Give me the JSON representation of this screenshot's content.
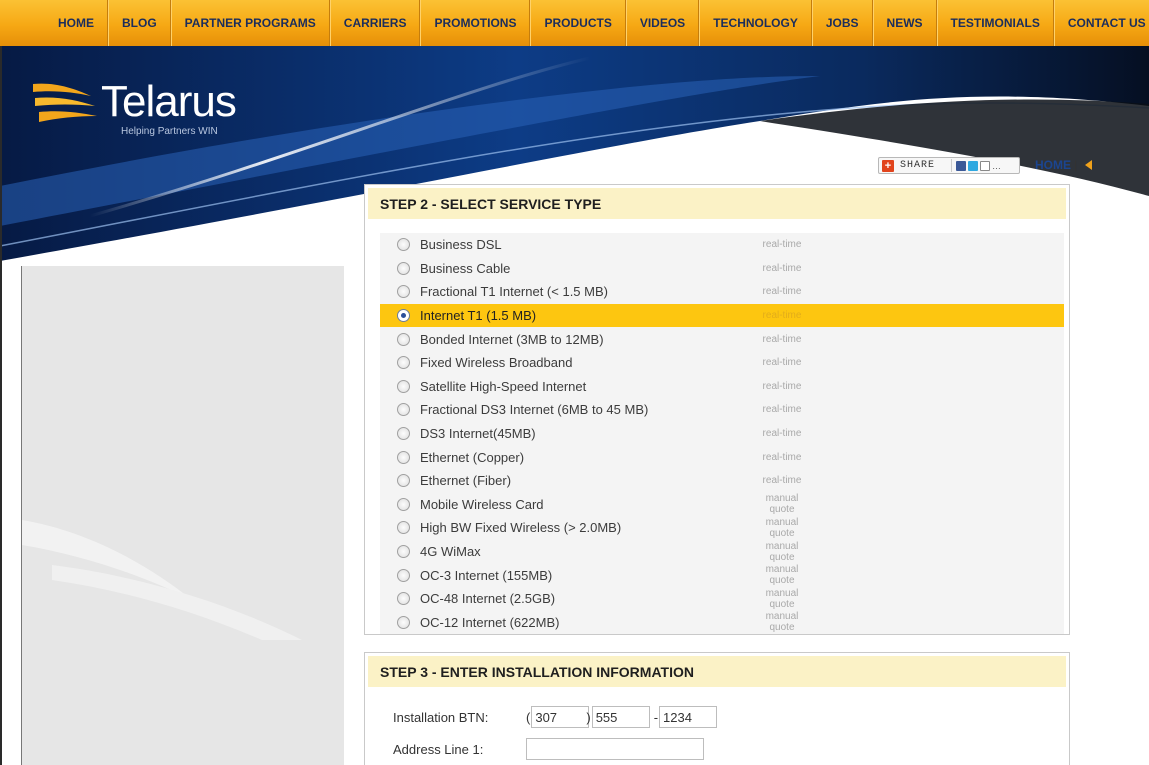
{
  "nav": {
    "items": [
      "HOME",
      "BLOG",
      "PARTNER PROGRAMS",
      "CARRIERS",
      "PROMOTIONS",
      "PRODUCTS",
      "VIDEOS",
      "TECHNOLOGY",
      "JOBS",
      "NEWS",
      "TESTIMONIALS",
      "CONTACT US"
    ]
  },
  "brand": {
    "name": "Telarus",
    "tagline": "Helping Partners WIN"
  },
  "share": {
    "label": "SHARE",
    "icons": [
      "facebook-icon",
      "twitter-icon",
      "email-icon",
      "more-icon"
    ]
  },
  "home_link": {
    "label": "HOME",
    "separator": "|"
  },
  "step2": {
    "title": "STEP 2 - SELECT SERVICE TYPE",
    "services": [
      {
        "name": "Business DSL",
        "type": "real-time",
        "selected": false
      },
      {
        "name": "Business Cable",
        "type": "real-time",
        "selected": false
      },
      {
        "name": "Fractional T1 Internet (< 1.5 MB)",
        "type": "real-time",
        "selected": false
      },
      {
        "name": "Internet T1 (1.5 MB)",
        "type": "real-time",
        "selected": true
      },
      {
        "name": "Bonded Internet (3MB to 12MB)",
        "type": "real-time",
        "selected": false
      },
      {
        "name": "Fixed Wireless Broadband",
        "type": "real-time",
        "selected": false
      },
      {
        "name": "Satellite High-Speed Internet",
        "type": "real-time",
        "selected": false
      },
      {
        "name": "Fractional DS3 Internet (6MB to 45 MB)",
        "type": "real-time",
        "selected": false
      },
      {
        "name": "DS3 Internet(45MB)",
        "type": "real-time",
        "selected": false
      },
      {
        "name": "Ethernet (Copper)",
        "type": "real-time",
        "selected": false
      },
      {
        "name": "Ethernet (Fiber)",
        "type": "real-time",
        "selected": false
      },
      {
        "name": "Mobile Wireless Card",
        "type": "manual quote",
        "selected": false
      },
      {
        "name": "High BW Fixed Wireless (> 2.0MB)",
        "type": "manual quote",
        "selected": false
      },
      {
        "name": "4G WiMax",
        "type": "manual quote",
        "selected": false
      },
      {
        "name": "OC-3 Internet (155MB)",
        "type": "manual quote",
        "selected": false
      },
      {
        "name": "OC-48 Internet (2.5GB)",
        "type": "manual quote",
        "selected": false
      },
      {
        "name": "OC-12 Internet (622MB)",
        "type": "manual quote",
        "selected": false
      }
    ]
  },
  "step3": {
    "title": "STEP 3 - ENTER INSTALLATION INFORMATION",
    "btn_label": "Installation BTN:",
    "btn_open_paren": "(",
    "btn_close_paren": ")",
    "btn_dash": "-",
    "btn_area": "307",
    "btn_prefix": "555",
    "btn_line": "1234",
    "address1_label": "Address Line 1:",
    "address1_value": ""
  },
  "colors": {
    "nav_orange": "#f6a814",
    "nav_text": "#1b2d5c",
    "selected_row": "#fdc610",
    "panel_header": "#fbf2c6",
    "header_blue": "#0c2c6b"
  }
}
